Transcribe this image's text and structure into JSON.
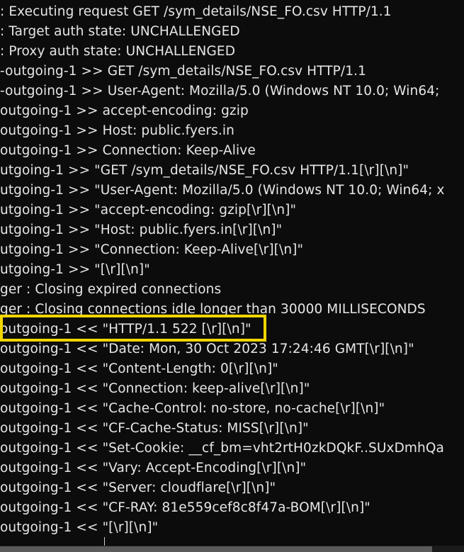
{
  "terminal": {
    "lines": [
      ": Executing request GET /sym_details/NSE_FO.csv HTTP/1.1",
      ": Target auth state: UNCHALLENGED",
      ": Proxy auth state: UNCHALLENGED",
      "-outgoing-1 >> GET /sym_details/NSE_FO.csv HTTP/1.1",
      "-outgoing-1 >> User-Agent: Mozilla/5.0 (Windows NT 10.0; Win64;",
      "outgoing-1 >> accept-encoding: gzip",
      "outgoing-1 >> Host: public.fyers.in",
      "outgoing-1 >> Connection: Keep-Alive",
      "utgoing-1 >> \"GET /sym_details/NSE_FO.csv HTTP/1.1[\\r][\\n]\"",
      "utgoing-1 >> \"User-Agent: Mozilla/5.0 (Windows NT 10.0; Win64; x",
      "utgoing-1 >> \"accept-encoding: gzip[\\r][\\n]\"",
      "utgoing-1 >> \"Host: public.fyers.in[\\r][\\n]\"",
      "utgoing-1 >> \"Connection: Keep-Alive[\\r][\\n]\"",
      "utgoing-1 >> \"[\\r][\\n]\"",
      "ger : Closing expired connections",
      "ger : Closing connections idle longer than 30000 MILLISECONDS",
      "outgoing-1 << \"HTTP/1.1 522 [\\r][\\n]\"",
      "outgoing-1 << \"Date: Mon, 30 Oct 2023 17:24:46 GMT[\\r][\\n]\"",
      "outgoing-1 << \"Content-Length: 0[\\r][\\n]\"",
      "outgoing-1 << \"Connection: keep-alive[\\r][\\n]\"",
      "outgoing-1 << \"Cache-Control: no-store, no-cache[\\r][\\n]\"",
      "outgoing-1 << \"CF-Cache-Status: MISS[\\r][\\n]\"",
      "outgoing-1 << \"Set-Cookie: __cf_bm=vht2rtH0zkDQkF..SUxDmhQa",
      "outgoing-1 << \"Vary: Accept-Encoding[\\r][\\n]\"",
      "outgoing-1 << \"Server: cloudflare[\\r][\\n]\"",
      "outgoing-1 << \"CF-RAY: 81e559cef8c8f47a-BOM[\\r][\\n]\"",
      "outgoing-1 << \"[\\r][\\n]\""
    ],
    "partial_line": "HTTP/1.1 522",
    "highlight_color": "#f2d600",
    "text_color": "#e6e6e6",
    "background_color": "#0c0c0c"
  }
}
